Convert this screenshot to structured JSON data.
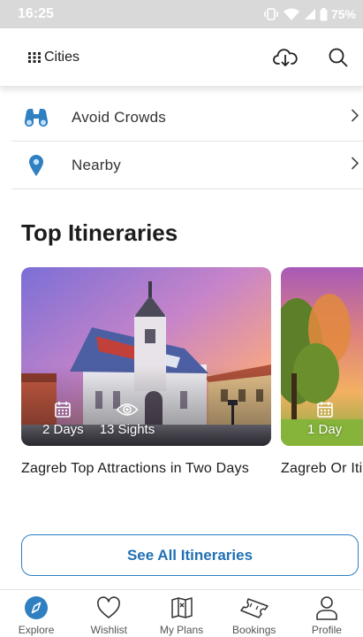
{
  "status_bar": {
    "time": "16:25",
    "battery": "75%"
  },
  "header": {
    "cities_label": "Cities",
    "icons": [
      "grid-icon",
      "cloud-download-icon",
      "search-icon"
    ]
  },
  "menu": {
    "items": [
      {
        "label": "Avoid Crowds",
        "icon": "binoculars-icon"
      },
      {
        "label": "Nearby",
        "icon": "location-pin-icon"
      }
    ]
  },
  "itineraries": {
    "title": "Top Itineraries",
    "cards": [
      {
        "days": "2 Days",
        "sights": "13 Sights",
        "title": "Zagreb Top Attractions in Two Days"
      },
      {
        "days": "1 Day",
        "title": "Zagreb One-Day Itinerary",
        "title_visible": "Zagreb Or Itinerary"
      }
    ],
    "see_all_label": "See All Itineraries"
  },
  "bottom_nav": {
    "items": [
      {
        "label": "Explore",
        "icon": "compass-icon",
        "active": true
      },
      {
        "label": "Wishlist",
        "icon": "heart-icon"
      },
      {
        "label": "My Plans",
        "icon": "map-icon"
      },
      {
        "label": "Bookings",
        "icon": "ticket-icon"
      },
      {
        "label": "Profile",
        "icon": "person-icon"
      }
    ]
  },
  "colors": {
    "accent": "#2f7fc1",
    "accent_text": "#2170b5",
    "status_bar": "#d9d9d9"
  }
}
